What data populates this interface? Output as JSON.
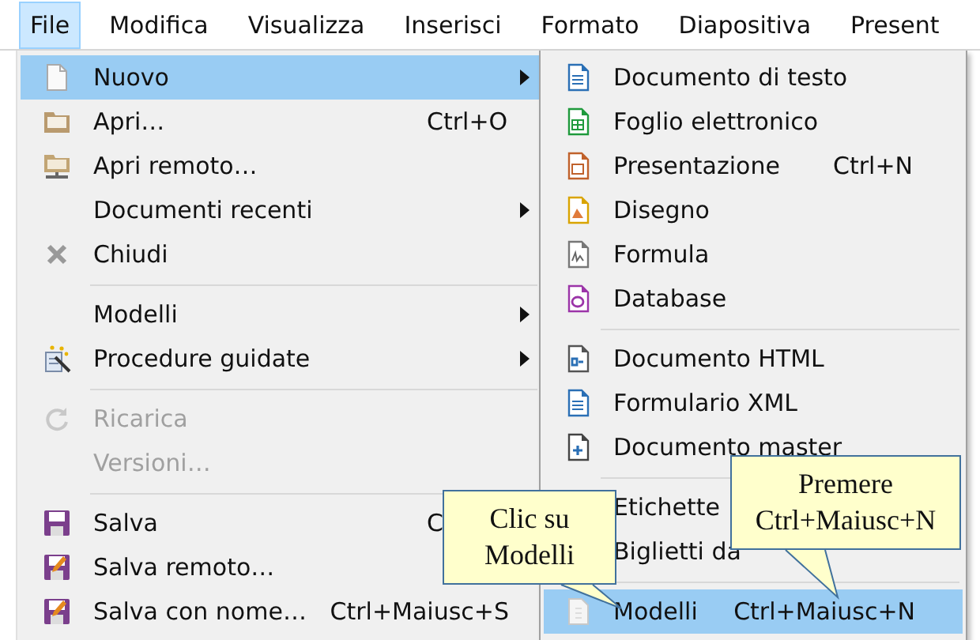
{
  "menubar": [
    {
      "label": "File",
      "selected": true
    },
    {
      "label": "Modifica",
      "selected": false
    },
    {
      "label": "Visualizza",
      "selected": false
    },
    {
      "label": "Inserisci",
      "selected": false
    },
    {
      "label": "Formato",
      "selected": false
    },
    {
      "label": "Diapositiva",
      "selected": false
    },
    {
      "label": "Present",
      "selected": false
    }
  ],
  "file_menu": [
    [
      {
        "label": "Nuovo",
        "submenu": true,
        "selected": true,
        "disabled": false
      },
      {
        "label": "Apri…",
        "shortcut": "Ctrl+O",
        "submenu": false,
        "selected": false,
        "disabled": false
      },
      {
        "label": "Apri remoto…",
        "submenu": false,
        "selected": false,
        "disabled": false
      },
      {
        "label": "Documenti recenti",
        "submenu": true,
        "selected": false,
        "disabled": false
      },
      {
        "label": "Chiudi",
        "submenu": false,
        "selected": false,
        "disabled": false
      }
    ],
    [
      {
        "label": "Modelli",
        "submenu": true,
        "selected": false,
        "disabled": false
      },
      {
        "label": "Procedure guidate",
        "submenu": true,
        "selected": false,
        "disabled": false
      }
    ],
    [
      {
        "label": "Ricarica",
        "submenu": false,
        "selected": false,
        "disabled": true
      },
      {
        "label": "Versioni…",
        "submenu": false,
        "selected": false,
        "disabled": true
      }
    ],
    [
      {
        "label": "Salva",
        "shortcut": "C",
        "selected": false,
        "disabled": false
      },
      {
        "label": "Salva remoto…",
        "selected": false,
        "disabled": false
      },
      {
        "label": "Salva con nome…",
        "shortcut": "Ctrl+Maiusc+S",
        "submenu": false,
        "selected": false,
        "disabled": false
      }
    ]
  ],
  "new_submenu": [
    [
      {
        "label": "Documento di testo",
        "selected": false
      },
      {
        "label": "Foglio elettronico",
        "selected": false
      },
      {
        "label": "Presentazione",
        "shortcut": "Ctrl+N",
        "selected": false
      },
      {
        "label": "Disegno",
        "selected": false
      },
      {
        "label": "Formula",
        "selected": false
      },
      {
        "label": "Database",
        "selected": false
      }
    ],
    [
      {
        "label": "Documento HTML",
        "selected": false
      },
      {
        "label": "Formulario XML",
        "selected": false
      },
      {
        "label": "Documento master",
        "selected": false
      }
    ],
    [
      {
        "label": "Etichette",
        "selected": false
      },
      {
        "label": "Biglietti da",
        "selected": false
      }
    ],
    [
      {
        "label": "Modelli",
        "shortcut": "Ctrl+Maiusc+N",
        "selected": true
      }
    ]
  ],
  "callouts": [
    {
      "lines": [
        "Clic su",
        "Modelli"
      ]
    },
    {
      "lines": [
        "Premere",
        "Ctrl+Maiusc+N"
      ]
    }
  ]
}
